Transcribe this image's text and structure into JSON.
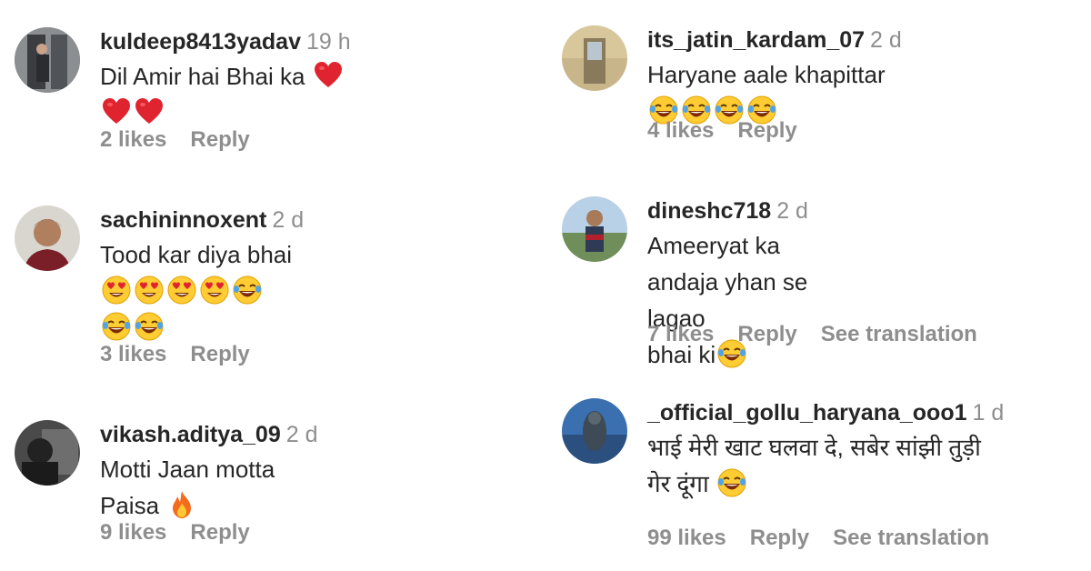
{
  "comments": [
    {
      "username": "kuldeep8413yadav",
      "time": "19 h",
      "text": "Dil Amir hai Bhai ka",
      "likes": "2 likes",
      "reply": "Reply"
    },
    {
      "username": "sachininnoxent",
      "time": "2 d",
      "text": "Tood kar diya bhai",
      "likes": "3 likes",
      "reply": "Reply"
    },
    {
      "username": "vikash.aditya_09",
      "time": "2 d",
      "text": "Motti Jaan motta Paisa",
      "likes": "9 likes",
      "reply": "Reply"
    },
    {
      "username": "its_jatin_kardam_07",
      "time": "2 d",
      "text": "Haryane aale khapittar",
      "likes": "4 likes",
      "reply": "Reply"
    },
    {
      "username": "dineshc718",
      "time": "2 d",
      "text_line1": "Ameeryat ka andaja yhan se lagao",
      "text_line2": "bhai ki",
      "likes": "7 likes",
      "reply": "Reply",
      "translate": "See translation"
    },
    {
      "username": "_official_gollu_haryana_ooo1",
      "time": "1 d",
      "text_line1": "भाई मेरी खाट घलवा दे, सबेर सांझी तुड़ी",
      "text_line2": "गेर दूंगा",
      "likes": "99 likes",
      "reply": "Reply",
      "translate": "See translation"
    }
  ],
  "icons": {
    "heart": "red-heart-emoji",
    "heart_eyes": "heart-eyes-emoji",
    "joy": "tears-of-joy-emoji",
    "fire": "fire-emoji"
  }
}
